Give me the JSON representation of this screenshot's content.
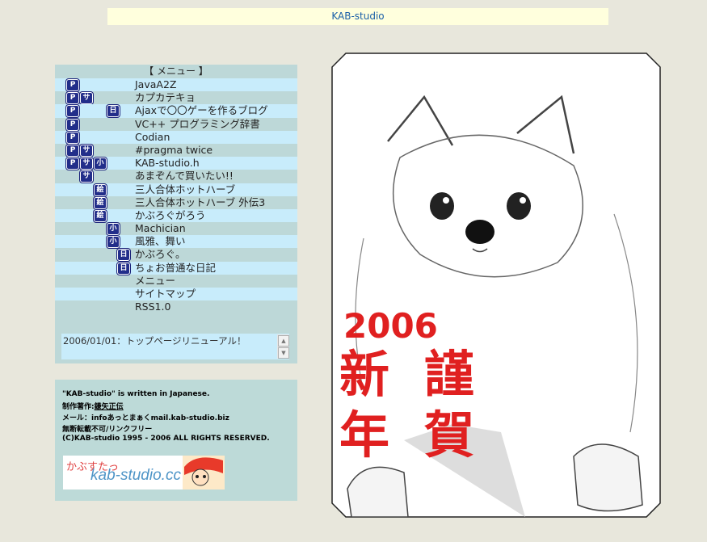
{
  "header": {
    "title": "KAB-studio"
  },
  "menu": {
    "title": "【 メニュー 】",
    "items": [
      {
        "label": "JavaA2Z",
        "badges": [
          "P"
        ]
      },
      {
        "label": "カプカテキョ",
        "badges": [
          "P",
          "サ"
        ]
      },
      {
        "label": "Ajaxで〇〇ゲーを作るブログ",
        "badges": [
          "P",
          "",
          "",
          "日"
        ]
      },
      {
        "label": "VC++ プログラミング辞書",
        "badges": [
          "P"
        ]
      },
      {
        "label": "Codian",
        "badges": [
          "P"
        ]
      },
      {
        "label": "#pragma twice",
        "badges": [
          "P",
          "サ"
        ]
      },
      {
        "label": "KAB-studio.h",
        "badges": [
          "P",
          "サ",
          "小"
        ]
      },
      {
        "label": "あまぞんで買いたい!!",
        "badges": [
          "",
          "サ"
        ]
      },
      {
        "label": "三人合体ホットハーブ",
        "badges": [
          "",
          "",
          "絵"
        ]
      },
      {
        "label": "三人合体ホットハーブ 外伝3",
        "badges": [
          "",
          "",
          "絵"
        ]
      },
      {
        "label": "かぶろぐがろう",
        "badges": [
          "",
          "",
          "絵"
        ]
      },
      {
        "label": "Machician",
        "badges": [
          "",
          "",
          "",
          "小"
        ]
      },
      {
        "label": "風雅、舞い",
        "badges": [
          "",
          "",
          "",
          "小"
        ]
      },
      {
        "label": "かぶろぐ。",
        "badges": [
          "",
          "",
          "",
          "",
          "日"
        ]
      },
      {
        "label": "ちょお普通な日記",
        "badges": [
          "",
          "",
          "",
          "",
          "日"
        ]
      },
      {
        "label": "メニュー",
        "badges": []
      },
      {
        "label": "サイトマップ",
        "badges": []
      },
      {
        "label": "RSS1.0",
        "badges": []
      }
    ]
  },
  "news": {
    "text": "2006/01/01：トップページリニューアル！",
    "scroll_up": "▲",
    "scroll_down": "▼"
  },
  "info": {
    "line1": "\"KAB-studio\" is written in Japanese.",
    "line2_prefix": "制作著作:",
    "line2_link": "鎌矢正伝",
    "line3": "メール：infoあっとまぁくmail.kab-studio.biz",
    "line4": "無断転載不可/リンクフリー",
    "line5": "(C)KAB-studio 1995 - 2006 ALL RIGHTS RESERVED."
  },
  "banner": {
    "text": "kab-studio.cc",
    "kana": "かぶすたっ"
  },
  "art": {
    "year": "2006",
    "greeting": "謹賀新年"
  },
  "colors": {
    "background": "#e8e7dc",
    "menu_bg": "#bdd8d8",
    "stripe": "#c8ecfb",
    "badge": "#222e8a",
    "title_link": "#1a5fa8",
    "greeting_red": "#e02020"
  }
}
